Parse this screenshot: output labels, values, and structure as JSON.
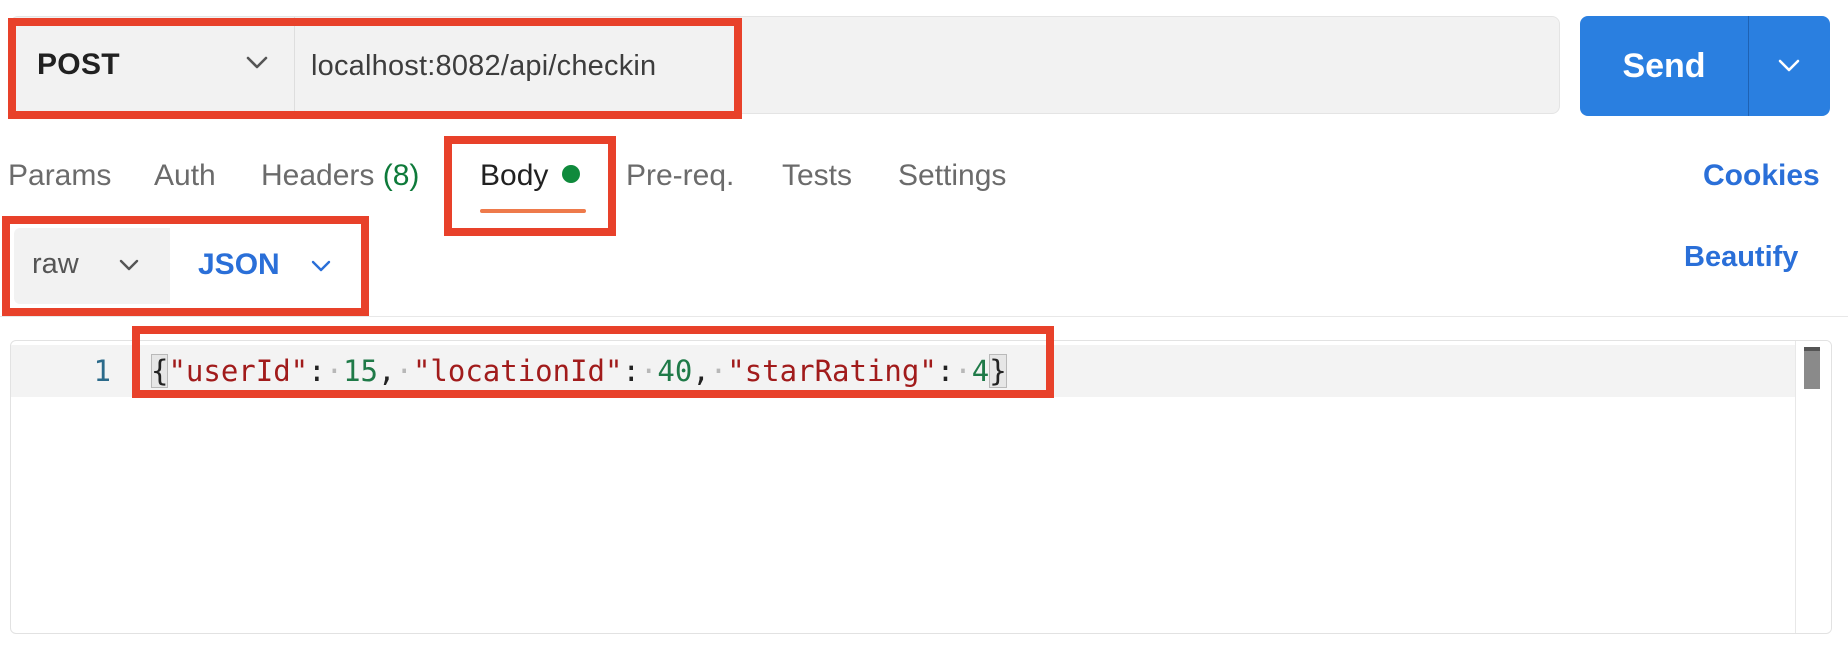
{
  "request": {
    "method": "POST",
    "url": "localhost:8082/api/checkin",
    "send_label": "Send"
  },
  "tabs": [
    {
      "label": "Params"
    },
    {
      "label": "Auth"
    },
    {
      "label": "Headers",
      "count": "(8)"
    },
    {
      "label": "Body",
      "active": true
    },
    {
      "label": "Pre-req."
    },
    {
      "label": "Tests"
    },
    {
      "label": "Settings"
    }
  ],
  "cookies_label": "Cookies",
  "body_options": {
    "mode": "raw",
    "language": "JSON",
    "beautify_label": "Beautify"
  },
  "editor": {
    "line_number": "1",
    "tokens": {
      "open_brace": "{",
      "key_user": "\"userId\"",
      "colon1": ":",
      "val_user": "15",
      "comma1": ",",
      "key_location": "\"locationId\"",
      "colon2": ":",
      "val_location": "40",
      "comma2": ",",
      "key_rating": "\"starRating\"",
      "colon3": ":",
      "val_rating": "4",
      "close_brace": "}"
    }
  },
  "colors": {
    "accent_blue": "#2a7fe0",
    "link_blue": "#2a6fd8",
    "tab_underline": "#ee7a4b",
    "active_dot": "#0f8a3c",
    "annotation_red": "#e8412a"
  },
  "icons": [
    "chevron-down-icon"
  ]
}
